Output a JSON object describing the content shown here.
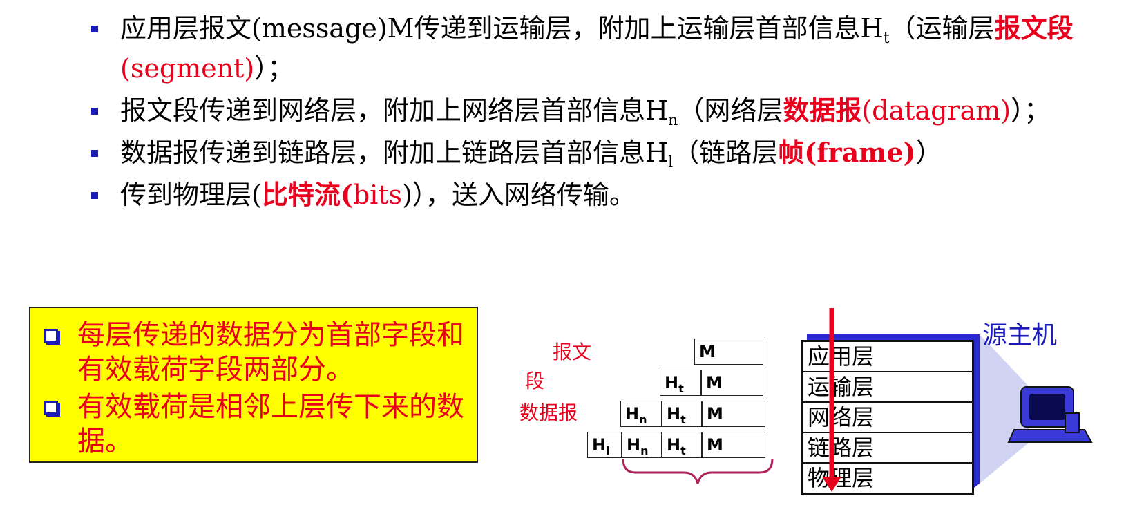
{
  "bullets": [
    {
      "parts": [
        {
          "t": "应用层报文(message)M传递到运输层，附加上运输层首部信息H"
        },
        {
          "t": "t",
          "sub": true
        },
        {
          "t": "（运输层"
        },
        {
          "t": "报文段",
          "red": true,
          "bold": true
        },
        {
          "t": "(segment)",
          "red": true
        },
        {
          "t": "）；"
        }
      ]
    },
    {
      "parts": [
        {
          "t": "报文段传递到网络层，附加上网络层首部信息H"
        },
        {
          "t": "n",
          "sub": true
        },
        {
          "t": "（网络层"
        },
        {
          "t": "数据报",
          "red": true,
          "bold": true
        },
        {
          "t": "(datagram)",
          "red": true
        },
        {
          "t": "）；"
        }
      ]
    },
    {
      "parts": [
        {
          "t": "数据报传递到链路层，附加上链路层首部信息H"
        },
        {
          "t": "l",
          "sub": true
        },
        {
          "t": "（链路层"
        },
        {
          "t": "帧(frame)",
          "red": true,
          "bold": true
        },
        {
          "t": "）"
        }
      ]
    },
    {
      "parts": [
        {
          "t": "传到物理层("
        },
        {
          "t": "比特流(",
          "red": true,
          "bold": true
        },
        {
          "t": "bits",
          "red": true
        },
        {
          "t": ")），送入网络传输。"
        }
      ]
    }
  ],
  "note_box": {
    "items": [
      "每层传递的数据分为首部字段和有效载荷字段两部分。",
      "有效载荷是相邻上层传下来的数据。"
    ]
  },
  "encapsulation": {
    "labels": {
      "segment_1": "报文",
      "segment_2": "段",
      "datagram": "数据报"
    },
    "header_t": "H",
    "header_t_sub": "t",
    "header_n": "H",
    "header_n_sub": "n",
    "header_l": "H",
    "header_l_sub": "l",
    "message": "M"
  },
  "protocol_stack": {
    "host_label": "源主机",
    "layers": [
      "应用层",
      "运输层",
      "网络层",
      "链路层",
      "物理层"
    ]
  },
  "colors": {
    "accent_red": "#e8001c",
    "accent_blue": "#1b1bb8",
    "note_bg": "#ffff00",
    "brace": "#b0205a"
  }
}
